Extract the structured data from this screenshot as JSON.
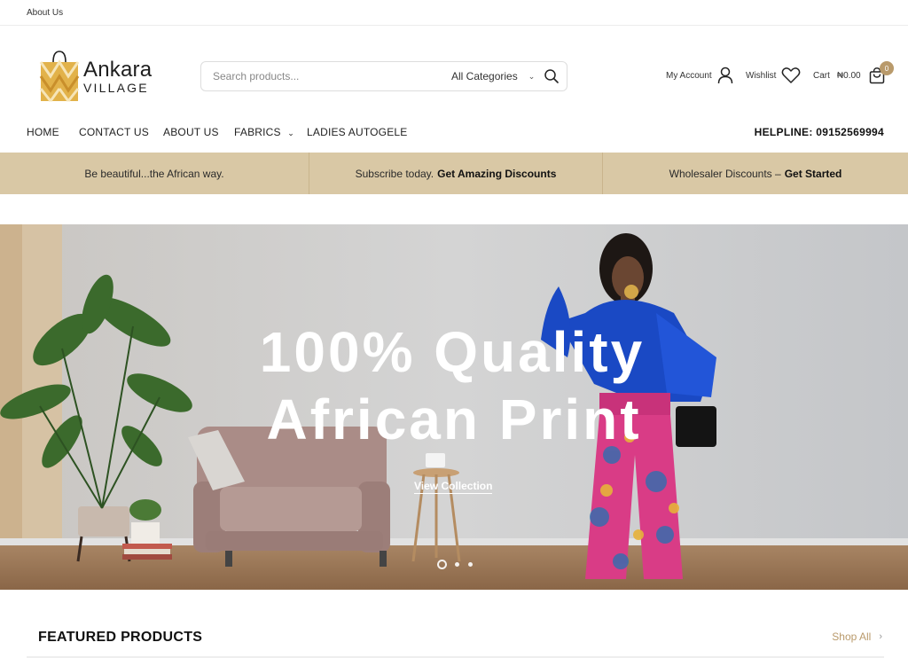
{
  "topbar": {
    "about_link": "About Us"
  },
  "brand": {
    "name_line1": "Ankara",
    "name_line2": "VILLAGE",
    "colors": {
      "gold": "#e2b24a",
      "dark": "#1e1e1e"
    }
  },
  "search": {
    "placeholder": "Search products...",
    "category": "All Categories"
  },
  "account": {
    "my_account": "My Account",
    "wishlist": "Wishlist",
    "cart_label": "Cart",
    "cart_total": "₦0.00",
    "cart_count": "0"
  },
  "nav": {
    "items": [
      "HOME",
      "CONTACT US",
      "ABOUT US",
      "FABRICS",
      "LADIES AUTOGELE"
    ],
    "helpline": "HELPLINE: 09152569994"
  },
  "promo": {
    "cell1": "Be beautiful...the African way.",
    "cell2_text": "Subscribe today.",
    "cell2_bold": "Get Amazing Discounts",
    "cell3_text": "Wholesaler Discounts –",
    "cell3_bold": "Get Started",
    "color": "#d9c8a5"
  },
  "hero": {
    "title_line1": "100% Quality",
    "title_line2": "African Print",
    "cta": "View Collection",
    "slides": 3,
    "active_slide": 1
  },
  "featured": {
    "title": "FEATURED PRODUCTS",
    "shop_all": "Shop All"
  },
  "colors": {
    "accent": "#b99a6b"
  }
}
